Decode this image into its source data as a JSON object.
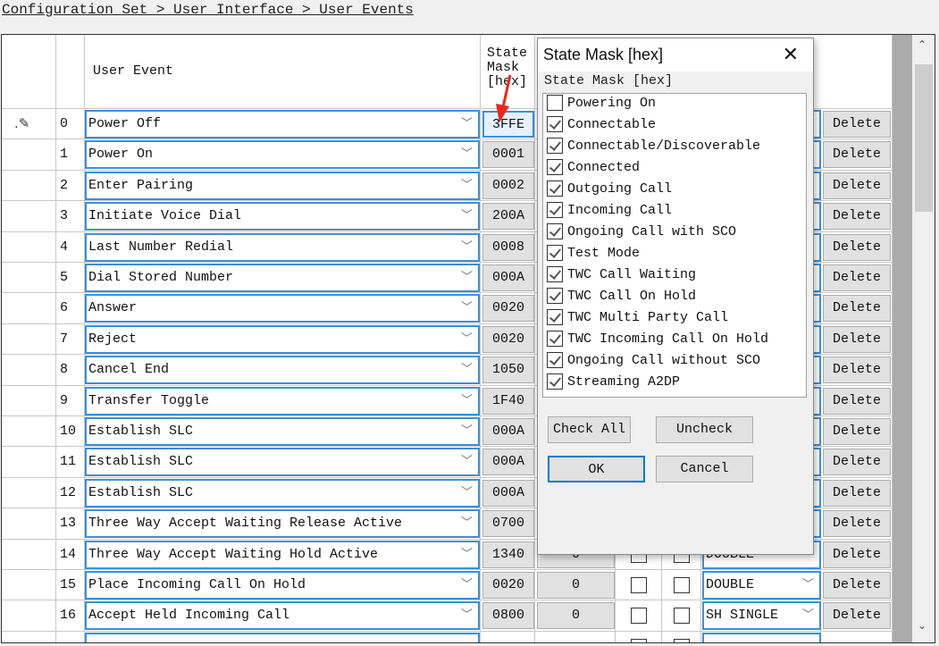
{
  "breadcrumb": "Configuration Set > User Interface > User Events",
  "table": {
    "headers": {
      "user_event": "User Event",
      "state_mask": "State\nMask\n[hex]"
    },
    "delete_label": "Delete",
    "edit_row": 0,
    "rows": [
      {
        "index": "0",
        "event": "Power Off",
        "mask": "3FFE"
      },
      {
        "index": "1",
        "event": "Power On",
        "mask": "0001"
      },
      {
        "index": "2",
        "event": "Enter Pairing",
        "mask": "0002"
      },
      {
        "index": "3",
        "event": "Initiate Voice Dial",
        "mask": "200A"
      },
      {
        "index": "4",
        "event": "Last Number Redial",
        "mask": "0008"
      },
      {
        "index": "5",
        "event": "Dial Stored Number",
        "mask": "000A"
      },
      {
        "index": "6",
        "event": "Answer",
        "mask": "0020"
      },
      {
        "index": "7",
        "event": "Reject",
        "mask": "0020"
      },
      {
        "index": "8",
        "event": "Cancel End",
        "mask": "1050"
      },
      {
        "index": "9",
        "event": "Transfer Toggle",
        "mask": "1F40"
      },
      {
        "index": "10",
        "event": "Establish SLC",
        "mask": "000A"
      },
      {
        "index": "11",
        "event": "Establish SLC",
        "mask": "000A"
      },
      {
        "index": "12",
        "event": "Establish SLC",
        "mask": "000A"
      },
      {
        "index": "13",
        "event": "Three Way Accept Waiting Release Active",
        "mask": "0700"
      },
      {
        "index": "14",
        "event": "Three Way Accept Waiting Hold Active",
        "mask": "1340",
        "value": "0",
        "button": "DOUBLE"
      },
      {
        "index": "15",
        "event": "Place Incoming Call On Hold",
        "mask": "0020",
        "value": "0",
        "button": "DOUBLE"
      },
      {
        "index": "16",
        "event": "Accept Held Incoming Call",
        "mask": "0800",
        "value": "0",
        "button": "SH SINGLE"
      }
    ]
  },
  "dialog": {
    "title": "State Mask [hex]",
    "label": "State Mask [hex]",
    "items": [
      {
        "label": "Powering On",
        "checked": false
      },
      {
        "label": "Connectable",
        "checked": true
      },
      {
        "label": "Connectable/Discoverable",
        "checked": true
      },
      {
        "label": "Connected",
        "checked": true
      },
      {
        "label": "Outgoing Call",
        "checked": true
      },
      {
        "label": "Incoming Call",
        "checked": true
      },
      {
        "label": "Ongoing Call with SCO",
        "checked": true
      },
      {
        "label": "Test Mode",
        "checked": true
      },
      {
        "label": "TWC Call Waiting",
        "checked": true
      },
      {
        "label": "TWC Call On Hold",
        "checked": true
      },
      {
        "label": "TWC Multi Party Call",
        "checked": true
      },
      {
        "label": "TWC Incoming Call On Hold",
        "checked": true
      },
      {
        "label": "Ongoing Call without SCO",
        "checked": true
      },
      {
        "label": "Streaming A2DP",
        "checked": true
      }
    ],
    "check_all": "Check All",
    "uncheck": "Uncheck",
    "ok": "OK",
    "cancel": "Cancel"
  },
  "colors": {
    "accent": "#3c8fd8",
    "annotation_arrow": "#e8281e"
  }
}
